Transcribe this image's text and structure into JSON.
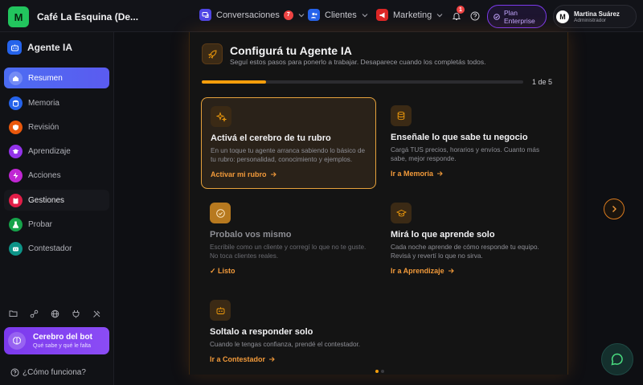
{
  "brand": {
    "initial": "M",
    "name": "Café La Esquina (De..."
  },
  "topnav": [
    {
      "label": "Conversaciones",
      "badge": "7",
      "icon": "chat-bubbles-icon",
      "color": "#6d5ce8"
    },
    {
      "label": "Clientes",
      "icon": "users-icon",
      "color": "#3b82f6"
    },
    {
      "label": "Marketing",
      "icon": "megaphone-icon",
      "color": "#ef4444"
    }
  ],
  "notifications": {
    "count": "1"
  },
  "plan": {
    "line1": "Plan",
    "line2": "Enterprise"
  },
  "user": {
    "initial": "M",
    "name": "Martina Suárez",
    "role": "Administrador"
  },
  "sidebar": {
    "title": "Agente IA",
    "items": [
      {
        "label": "Resumen",
        "icon": "home-icon",
        "color": "#4c6df2"
      },
      {
        "label": "Memoria",
        "icon": "database-icon",
        "color": "#3b82f6"
      },
      {
        "label": "Revisión",
        "icon": "shield-icon",
        "color": "#f97316"
      },
      {
        "label": "Aprendizaje",
        "icon": "graduation-cap-icon",
        "color": "#9333ea"
      },
      {
        "label": "Acciones",
        "icon": "bolt-icon",
        "color": "#c026d3"
      },
      {
        "label": "Gestiones",
        "icon": "clipboard-icon",
        "color": "#e11d48"
      },
      {
        "label": "Probar",
        "icon": "flask-icon",
        "color": "#16a34a"
      },
      {
        "label": "Contestador",
        "icon": "bot-icon",
        "color": "#0d9488"
      }
    ],
    "brain": {
      "title": "Cerebro del bot",
      "subtitle": "Qué sabe y qué le falta"
    },
    "help": "¿Cómo funciona?"
  },
  "onboarding": {
    "title": "Configurá tu Agente IA",
    "subtitle": "Seguí estos pasos para ponerlo a trabajar. Desaparece cuando los completás todos.",
    "progress": 0.2,
    "count": "1 de 5",
    "cards": [
      {
        "title": "Activá el cerebro de tu rubro",
        "desc": "En un toque tu agente arranca sabiendo lo básico de tu rubro: personalidad, conocimiento y ejemplos.",
        "link": "Activar mi rubro",
        "icon": "sparkles-icon"
      },
      {
        "title": "Enseñale lo que sabe tu negocio",
        "desc": "Cargá TUS precios, horarios y envíos. Cuanto más sabe, mejor responde.",
        "link": "Ir a Memoria",
        "icon": "database-icon"
      },
      {
        "title": "Probalo vos mismo",
        "desc": "Escribile como un cliente y corregí lo que no te guste. No toca clientes reales.",
        "link": "✓ Listo",
        "icon": "check-circle-icon"
      },
      {
        "title": "Mirá lo que aprende solo",
        "desc": "Cada noche aprende de cómo responde tu equipo. Revisá y revertí lo que no sirva.",
        "link": "Ir a Aprendizaje",
        "icon": "graduation-cap-icon"
      },
      {
        "title": "Soltalo a responder solo",
        "desc": "Cuando le tengas confianza, prendé el contestador.",
        "link": "Ir a Contestador",
        "icon": "bot-icon"
      }
    ]
  },
  "colors": {
    "accent": "#f59e0b",
    "link": "#f29a3a",
    "active": "#4c6df2"
  }
}
